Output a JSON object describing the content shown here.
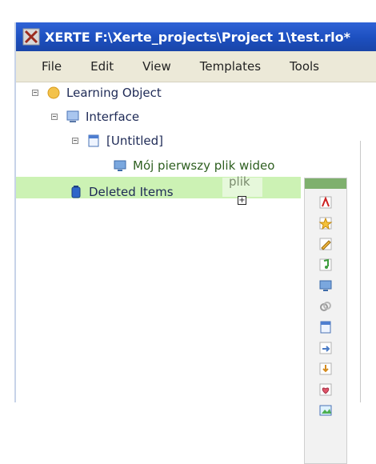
{
  "window": {
    "title": "XERTE F:\\Xerte_projects\\Project 1\\test.rlo*"
  },
  "menu": {
    "items": [
      "File",
      "Edit",
      "View",
      "Templates",
      "Tools"
    ]
  },
  "tree": {
    "items": [
      {
        "label": "Learning Object"
      },
      {
        "label": "Interface"
      },
      {
        "label": "[Untitled]"
      },
      {
        "label": "Mój pierwszy plik wideo"
      },
      {
        "label": "Deleted Items"
      }
    ]
  },
  "overlay": {
    "drag_text": "plik"
  },
  "colors": {
    "selection": "#ccf2b4",
    "palette_header": "#7fb06e",
    "titlebar": "#1c4fbf"
  },
  "palette": {
    "tools": [
      "text-tool-icon",
      "star-tool-icon",
      "pencil-tool-icon",
      "music-tool-icon",
      "monitor-tool-icon",
      "link-tool-icon",
      "page-tool-icon",
      "arrow-tool-icon",
      "download-tool-icon",
      "heart-tool-icon",
      "image-tool-icon"
    ]
  }
}
